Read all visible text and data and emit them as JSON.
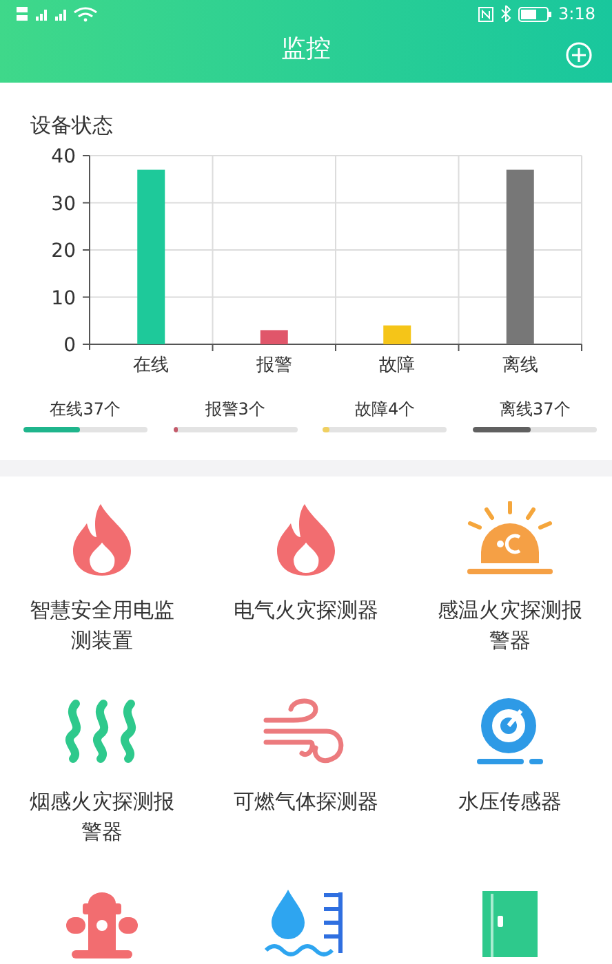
{
  "status_bar": {
    "time": "3:18"
  },
  "header": {
    "title": "监控"
  },
  "device_status": {
    "title": "设备状态",
    "chart_data": {
      "type": "bar",
      "categories": [
        "在线",
        "报警",
        "故障",
        "离线"
      ],
      "values": [
        37,
        3,
        4,
        37
      ],
      "grid": true,
      "colors": [
        "#1ec99a",
        "#e0566a",
        "#f5c518",
        "#777777"
      ],
      "ylim": [
        0,
        40
      ],
      "yticks": [
        0,
        10,
        20,
        30,
        40
      ]
    },
    "summary": [
      {
        "label": "在线37个",
        "level": 0.46,
        "color": "#1fb58c"
      },
      {
        "label": "报警3个",
        "level": 0.04,
        "color": "#c45a6a"
      },
      {
        "label": "故障4个",
        "level": 0.05,
        "color": "#f0d060"
      },
      {
        "label": "离线37个",
        "level": 0.46,
        "color": "#606060"
      }
    ]
  },
  "devices": [
    {
      "label": "智慧安全用电监测装置",
      "kind": "flame"
    },
    {
      "label": "电气火灾探测器",
      "kind": "flame"
    },
    {
      "label": "感温火灾探测报警器",
      "kind": "alarm"
    },
    {
      "label": "烟感火灾探测报警器",
      "kind": "smoke"
    },
    {
      "label": "可燃气体探测器",
      "kind": "gas"
    },
    {
      "label": "水压传感器",
      "kind": "gauge"
    },
    {
      "kind": "hydrant"
    },
    {
      "kind": "water"
    },
    {
      "kind": "door"
    }
  ]
}
